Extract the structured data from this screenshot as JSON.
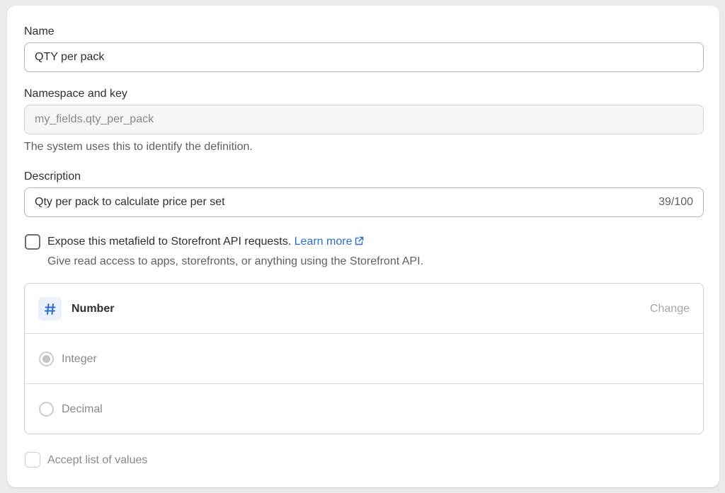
{
  "name": {
    "label": "Name",
    "value": "QTY per pack"
  },
  "namespace": {
    "label": "Namespace and key",
    "value": "my_fields.qty_per_pack",
    "help": "The system uses this to identify the definition."
  },
  "description": {
    "label": "Description",
    "value": "Qty per pack to calculate price per set",
    "counter": "39/100"
  },
  "storefront": {
    "label": "Expose this metafield to Storefront API requests.",
    "link": "Learn more",
    "link_icon": "external-link-icon",
    "help": "Give read access to apps, storefronts, or anything using the Storefront API.",
    "checked": false
  },
  "type": {
    "icon": "hash-icon",
    "name": "Number",
    "change_label": "Change",
    "accent": "#2c6ecb",
    "options": [
      {
        "label": "Integer",
        "selected": true
      },
      {
        "label": "Decimal",
        "selected": false
      }
    ]
  },
  "list_option": {
    "label": "Accept list of values",
    "checked": false
  }
}
